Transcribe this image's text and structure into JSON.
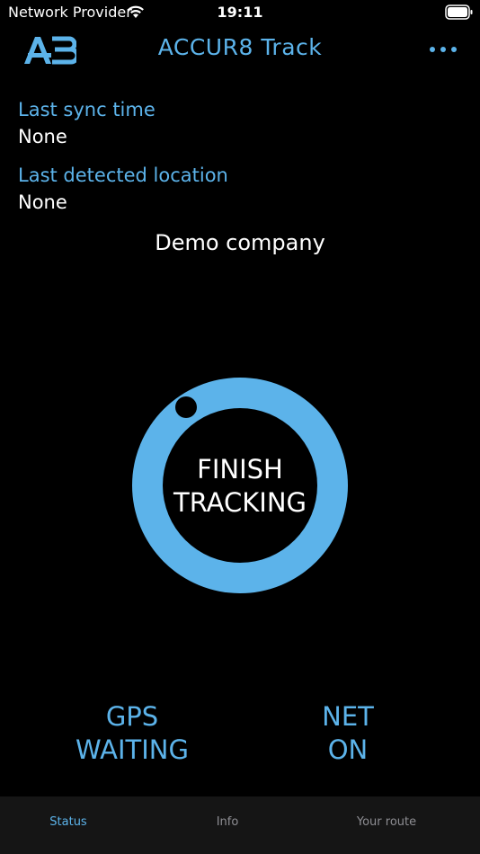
{
  "status_bar": {
    "carrier": "Network Provider",
    "time": "19:11"
  },
  "nav": {
    "title": "ACCUR8 Track",
    "more_icon": "more-horizontal-icon"
  },
  "sync": {
    "label": "Last sync time",
    "value": "None"
  },
  "location": {
    "label": "Last detected location",
    "value": "None"
  },
  "company": "Demo company",
  "tracking_button": {
    "line1": "FINISH",
    "line2": "TRACKING"
  },
  "gps": {
    "label": "GPS",
    "state": "WAITING"
  },
  "net": {
    "label": "NET",
    "state": "ON"
  },
  "tabs": [
    {
      "label": "Status",
      "active": true
    },
    {
      "label": "Info",
      "active": false
    },
    {
      "label": "Your route",
      "active": false
    }
  ],
  "colors": {
    "accent": "#5cb3ea",
    "background": "#000000",
    "tab_bar": "#151515",
    "tab_inactive": "#8e8e93"
  }
}
